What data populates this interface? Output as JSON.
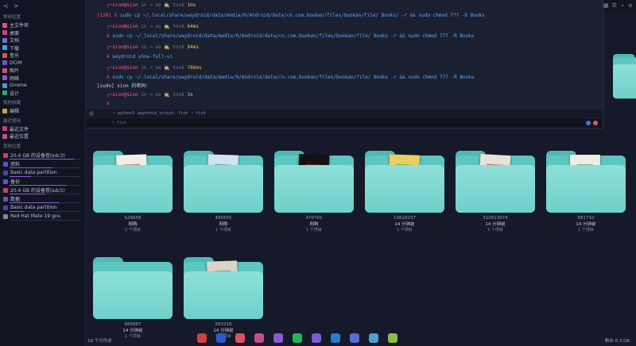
{
  "sidebar": {
    "nav": {
      "back": "<",
      "forward": ">"
    },
    "sections": [
      {
        "title": "常用位置",
        "items": [
          {
            "label": "主文件夹",
            "color": "#e0508a"
          },
          {
            "label": "桌面",
            "color": "#d04080"
          },
          {
            "label": "文档",
            "color": "#5a7ad0"
          },
          {
            "label": "下载",
            "color": "#40a0e0"
          },
          {
            "label": "音乐",
            "color": "#e05050"
          },
          {
            "label": "DCIM",
            "color": "#6a58c8"
          },
          {
            "label": "图片",
            "color": "#d05070"
          },
          {
            "label": "网络",
            "color": "#8a5ad0"
          },
          {
            "label": "Gnome",
            "color": "#4aa0d0"
          },
          {
            "label": "设计",
            "color": "#3aa070"
          }
        ]
      },
      {
        "title": "我的收藏",
        "items": [
          {
            "label": "编辑",
            "color": "#d0a040"
          }
        ]
      },
      {
        "title": "最近使用",
        "items": [
          {
            "label": "最近文件",
            "color": "#c04080"
          },
          {
            "label": "最近位置",
            "color": "#c05090"
          }
        ]
      }
    ],
    "devices": [
      {
        "label": "20.4 GB 的设备卷(sdc3)",
        "color": "#d04060",
        "fill": 0.9
      },
      {
        "label": "资料",
        "color": "#6050d0",
        "fill": 0.6
      },
      {
        "label": "Basic data partition",
        "color": "#5040b0",
        "fill": 0.3
      },
      {
        "label": "备份",
        "color": "#6050d0",
        "fill": 0.8
      },
      {
        "label": "20.4 GB 的设备卷(sdc5)",
        "color": "#d04060",
        "fill": 0.5
      },
      {
        "label": "数据",
        "color": "#6050d0",
        "fill": 0.7
      },
      {
        "label": "Basic data partition",
        "color": "#5040b0",
        "fill": 0.2
      },
      {
        "label": "Red Hat Mate 19 gns",
        "color": "#888888",
        "fill": 0.0
      }
    ],
    "other_title": "其他位置"
  },
  "terminal": {
    "blocks": [
      {
        "user": "sion@sion",
        "in": "in",
        "dir": "~",
        "as": "as",
        "took": "took",
        "time": "1ms"
      },
      {
        "error": "[130]",
        "cmd": "sudo cp ~/.local/share/waydroid/data/media/0/Android/data/cn.com.bookan/files/bookan/file/ Books/ -r && sudo chmod 777 -R Books"
      },
      {
        "user": "sion@sion",
        "in": "in",
        "dir": "~",
        "as": "as",
        "took": "took",
        "time": "64ms"
      },
      {
        "cmd": "sudo cp ~/.local/share/waydroid/data/media/0/Android/data/cn.com.bookan/files/bookan/file/ Books -r && sudo chmod 777 -R Books"
      },
      {
        "user": "sion@sion",
        "in": "in",
        "dir": "~",
        "as": "as",
        "took": "took",
        "time": "84ms"
      },
      {
        "cmd": "waydroid show-full-ui"
      },
      {
        "user": "sion@sion",
        "in": "in",
        "dir": "~",
        "as": "as",
        "took": "took",
        "time": "786ms"
      },
      {
        "cmd": "sudo cp ~/.local/share/waydroid/data/media/0/Android/data/cn.com.bookan/files/bookan/file/ Books -r && sudo chmod 777 -R Books"
      },
      {
        "plain": "[sudo] sion 的密码："
      },
      {
        "user": "sion@sion",
        "in": "in",
        "dir": "~",
        "as": "as",
        "took": "took",
        "time": "3s"
      }
    ],
    "prompt_symbol": "λ",
    "tabs": [
      "~ python3",
      "waydroid_script: fish",
      "~ fish"
    ],
    "status": "~ fish"
  },
  "files": {
    "folders": [
      {
        "title": "529958",
        "size": "网购",
        "count": "1 个项目",
        "cover_bg": "#f2ede6",
        "cover_accent": "#b03030"
      },
      {
        "title": "495655",
        "size": "网购",
        "count": "1 个项目",
        "cover_bg": "#cfe3f2",
        "cover_accent": "#3a6aa8"
      },
      {
        "title": "470701",
        "size": "网购",
        "count": "1 个项目",
        "cover_bg": "#121212",
        "cover_accent": "#c02020"
      },
      {
        "title": "10629237",
        "size": "14 分钟前",
        "count": "1 个项目",
        "cover_bg": "#e8d060",
        "cover_accent": "#40a060"
      },
      {
        "title": "310013074",
        "size": "14 分钟前",
        "count": "1 个项目",
        "cover_bg": "#e8e2d6",
        "cover_accent": "#c03030"
      },
      {
        "title": "681710",
        "size": "14 分钟前",
        "count": "1 个项目",
        "cover_bg": "#f0ede6",
        "cover_accent": "#2a8a5a"
      },
      {
        "title": "680887",
        "size": "14 分钟前",
        "count": "1 个项目",
        "cover_bg": null,
        "cover_accent": null
      },
      {
        "title": "563216",
        "size": "14 分钟前",
        "count": "1 个项目",
        "cover_bg": "#d8d4c8",
        "cover_accent": "#4a7a6a"
      }
    ],
    "status": "16 个文件夹",
    "free_space": "剩余 8.3 GB"
  },
  "dock": {
    "apps": [
      {
        "name": "app-icon-1",
        "color": "#d04040"
      },
      {
        "name": "terminal-icon",
        "color": "#2a5ad0"
      },
      {
        "name": "files-icon",
        "color": "#e05060"
      },
      {
        "name": "settings-icon",
        "color": "#c0508a"
      },
      {
        "name": "game-icon",
        "color": "#8a5ad0"
      },
      {
        "name": "spotify-icon",
        "color": "#1db954"
      },
      {
        "name": "vpn-icon",
        "color": "#7a5ad8"
      },
      {
        "name": "vscode-icon",
        "color": "#2a7ad0"
      },
      {
        "name": "star-icon",
        "color": "#5a6ad8"
      },
      {
        "name": "browser-icon",
        "color": "#4aa0d0"
      },
      {
        "name": "android-icon",
        "color": "#8ac040"
      }
    ]
  }
}
